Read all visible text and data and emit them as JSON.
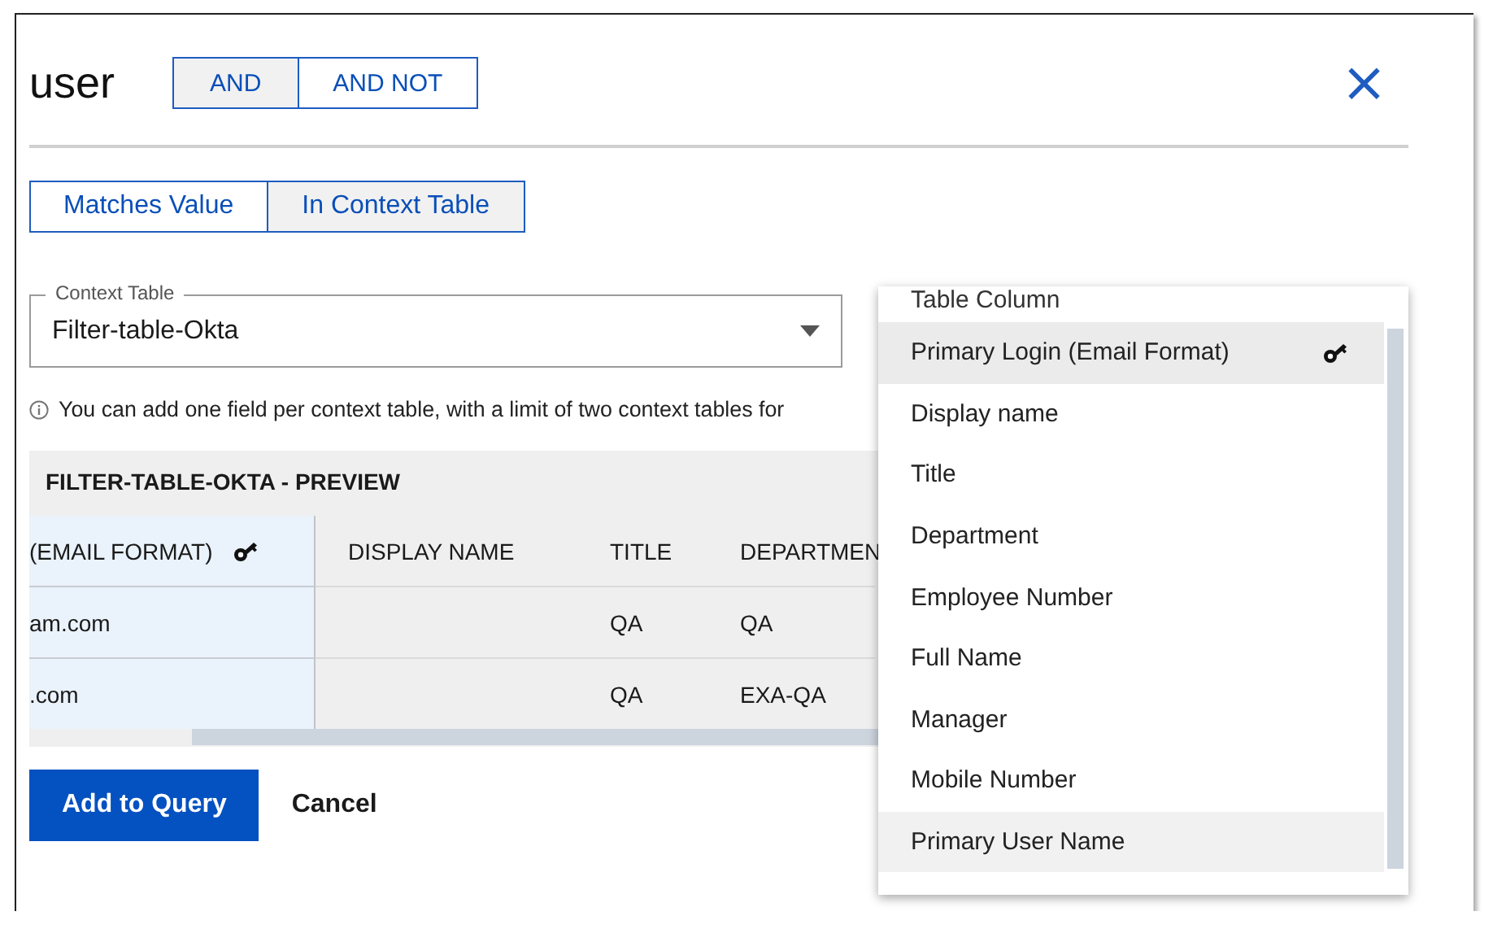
{
  "dialog": {
    "title": "user",
    "operators": [
      {
        "label": "AND",
        "selected": true
      },
      {
        "label": "AND NOT",
        "selected": false
      }
    ],
    "close_icon": "×"
  },
  "match_modes": [
    {
      "label": "Matches Value",
      "selected": false
    },
    {
      "label": "In Context Table",
      "selected": true
    }
  ],
  "context_table": {
    "label": "Context Table",
    "value": "Filter-table-Okta"
  },
  "info": "You can add one field per context table, with a limit of two context tables for",
  "preview": {
    "title": "FILTER-TABLE-OKTA - PREVIEW",
    "columns": [
      {
        "label": "(EMAIL FORMAT)",
        "key": true
      },
      {
        "label": "DISPLAY NAME",
        "key": false
      },
      {
        "label": "TITLE",
        "key": false
      },
      {
        "label": "DEPARTMEN",
        "key": false
      }
    ],
    "rows": [
      [
        "am.com",
        "",
        "QA",
        "QA"
      ],
      [
        ".com",
        "",
        "QA",
        "EXA-QA"
      ]
    ]
  },
  "buttons": {
    "primary": "Add to Query",
    "secondary": "Cancel"
  },
  "table_column_menu": {
    "header": "Table Column",
    "items": [
      {
        "label": "Primary Login (Email Format)",
        "key": true,
        "selected": true,
        "hovered": false
      },
      {
        "label": "Display name",
        "key": false,
        "selected": false,
        "hovered": false
      },
      {
        "label": "Title",
        "key": false,
        "selected": false,
        "hovered": false
      },
      {
        "label": "Department",
        "key": false,
        "selected": false,
        "hovered": false
      },
      {
        "label": "Employee Number",
        "key": false,
        "selected": false,
        "hovered": false
      },
      {
        "label": "Full Name",
        "key": false,
        "selected": false,
        "hovered": false
      },
      {
        "label": "Manager",
        "key": false,
        "selected": false,
        "hovered": false
      },
      {
        "label": "Mobile Number",
        "key": false,
        "selected": false,
        "hovered": false
      },
      {
        "label": "Primary User Name",
        "key": false,
        "selected": false,
        "hovered": true
      }
    ]
  }
}
